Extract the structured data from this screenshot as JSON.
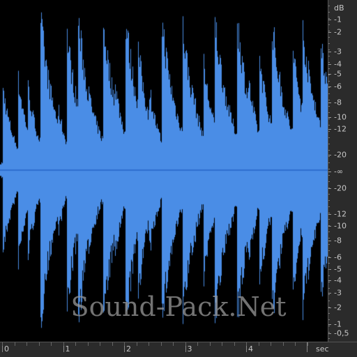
{
  "colors": {
    "waveform": "#4a8de6",
    "waveform_dark": "#2f6fd0",
    "background": "#000000",
    "ruler": "#2b2b2b",
    "ruler_text": "#c8c8c8"
  },
  "watermark": "Sound-Pack.Net",
  "db_ruler": {
    "unit": "dB",
    "labels": [
      "-1",
      "-2",
      "-3",
      "-4",
      "-5",
      "-6",
      "-8",
      "-10",
      "-12",
      "-20",
      "-∞",
      "-20",
      "-12",
      "-10",
      "-8",
      "-6",
      "-5",
      "-4",
      "-3",
      "-2",
      "-1",
      "-0,5"
    ]
  },
  "time_ruler": {
    "unit": "sec",
    "labels": [
      "0",
      "1",
      "2",
      "3",
      "4"
    ]
  }
}
